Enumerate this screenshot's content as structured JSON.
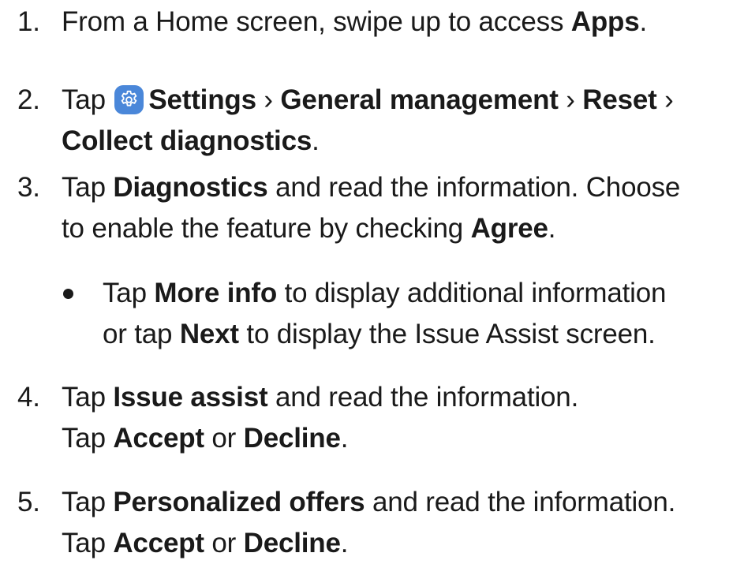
{
  "steps": [
    {
      "number": "1.",
      "parts": [
        "From a Home screen, swipe up to access ",
        "Apps",
        "."
      ]
    },
    {
      "number": "2.",
      "parts": [
        "Tap ",
        "Settings",
        " › ",
        "General management",
        " › ",
        "Reset",
        " ›",
        "Collect diagnostics",
        "."
      ]
    },
    {
      "number": "3.",
      "parts": [
        "Tap ",
        "Diagnostics",
        " and read the information. Choose",
        "to enable the feature by checking ",
        "Agree",
        "."
      ]
    },
    {
      "number": "",
      "parts": [
        "Tap ",
        "More info",
        " to display additional information",
        "or tap ",
        "Next",
        " to display the Issue Assist screen."
      ]
    },
    {
      "number": "4.",
      "parts": [
        "Tap ",
        "Issue assist",
        " and read the information.",
        "Tap ",
        "Accept",
        " or ",
        "Decline",
        "."
      ]
    },
    {
      "number": "5.",
      "parts": [
        "Tap ",
        "Personalized offers",
        " and read the information.",
        "Tap ",
        "Accept",
        " or ",
        "Decline",
        "."
      ]
    }
  ],
  "icons": {
    "settings": "gear-icon"
  },
  "colors": {
    "settings_icon_bg": "#4a87d9",
    "text": "#1a1a1a"
  }
}
